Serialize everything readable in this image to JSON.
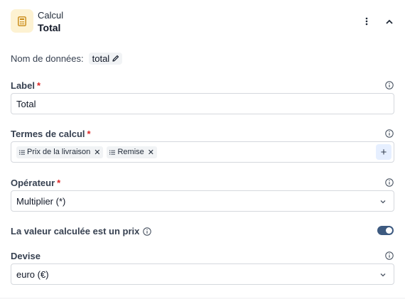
{
  "header": {
    "type_label": "Calcul",
    "title": "Total"
  },
  "data_name": {
    "label": "Nom de données:",
    "value": "total"
  },
  "label_field": {
    "label": "Label",
    "required_mark": "*",
    "value": "Total"
  },
  "terms_field": {
    "label": "Termes de calcul",
    "required_mark": "*",
    "chips": [
      "Prix de la livraison",
      "Remise"
    ],
    "add_button": "+"
  },
  "operator_field": {
    "label": "Opérateur",
    "required_mark": "*",
    "value": "Multiplier (*)"
  },
  "price_toggle": {
    "label": "La valeur calculée est un prix",
    "enabled": true
  },
  "currency_field": {
    "label": "Devise",
    "value": "euro (€)"
  },
  "colors": {
    "badge_bg": "#fdf2d2",
    "badge_icon": "#c98a16",
    "required": "#dc2626",
    "toggle_on": "#3d5a80",
    "plus_bg": "#e6efff"
  }
}
